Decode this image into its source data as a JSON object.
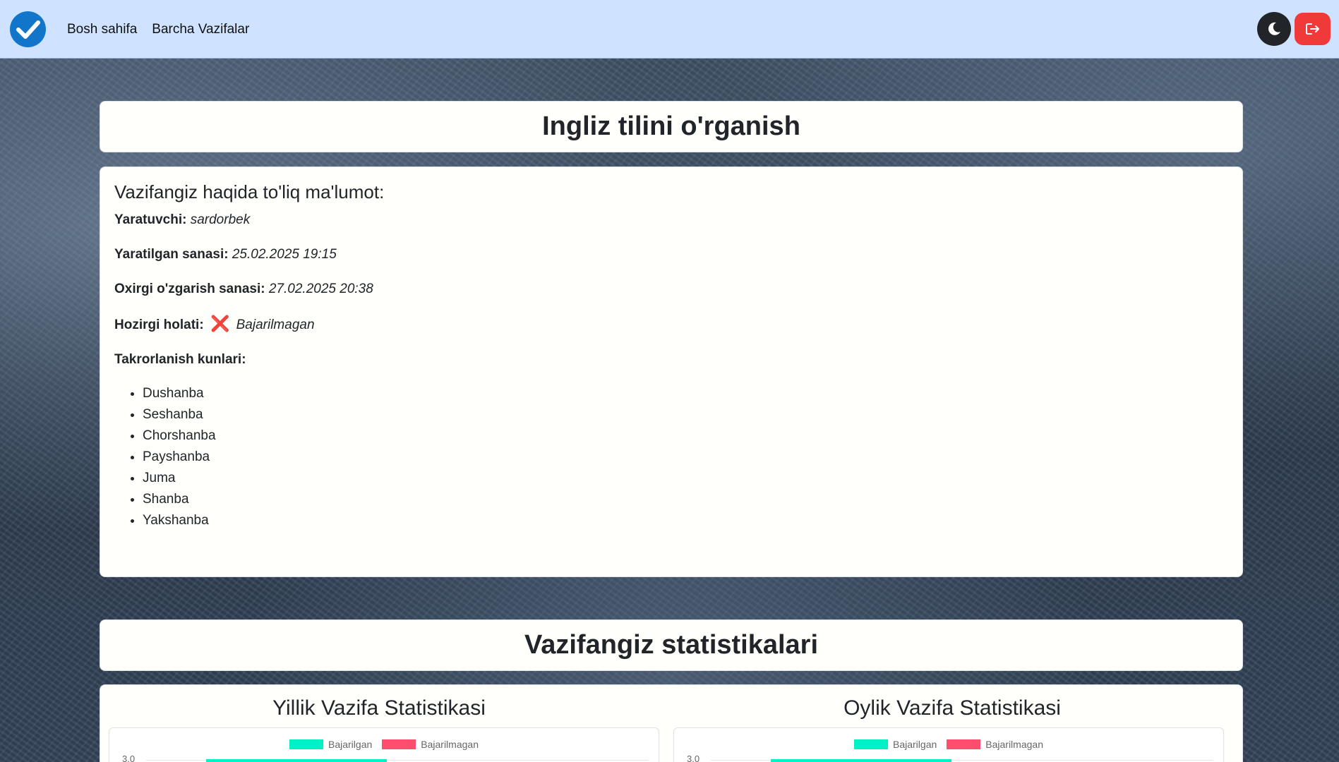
{
  "nav": {
    "links": [
      "Bosh sahifa",
      "Barcha Vazifalar"
    ],
    "brand_icon": "check-circle-icon",
    "theme_icon": "moon-icon",
    "logout_icon": "logout-icon",
    "colors": {
      "navbar": "#cfe2ff",
      "brand": "#1176c9",
      "logout": "#f03a3a",
      "theme": "#212529"
    }
  },
  "task": {
    "title": "Ingliz tilini o'rganish",
    "info_heading": "Vazifangiz haqida to'liq ma'lumot:",
    "creator_label": "Yaratuvchi:",
    "creator": "sardorbek",
    "created_label": "Yaratilgan sanasi:",
    "created": "25.02.2025 19:15",
    "modified_label": "Oxirgi o'zgarish sanasi:",
    "modified": "27.02.2025 20:38",
    "status_label": "Hozirgi holati:",
    "status_icon": "❌",
    "status": "Bajarilmagan",
    "repeat_label": "Takrorlanish kunlari:",
    "days": [
      "Dushanba",
      "Seshanba",
      "Chorshanba",
      "Payshanba",
      "Juma",
      "Shanba",
      "Yakshanba"
    ]
  },
  "stats": {
    "title": "Vazifangiz statistikalari"
  },
  "chart_data": [
    {
      "type": "bar",
      "title": "Yillik Vazifa Statistikasi",
      "series": [
        {
          "name": "Bajarilgan",
          "color": "#00f0c8"
        },
        {
          "name": "Bajarilmagan",
          "color": "#ff4d6d"
        }
      ],
      "y_ticks_visible": [
        "3.0"
      ],
      "ylim": [
        0,
        3
      ]
    },
    {
      "type": "bar",
      "title": "Oylik Vazifa Statistikasi",
      "series": [
        {
          "name": "Bajarilgan",
          "color": "#00f0c8"
        },
        {
          "name": "Bajarilmagan",
          "color": "#ff4d6d"
        }
      ],
      "y_ticks_visible": [
        "3.0"
      ],
      "ylim": [
        0,
        3
      ]
    }
  ]
}
